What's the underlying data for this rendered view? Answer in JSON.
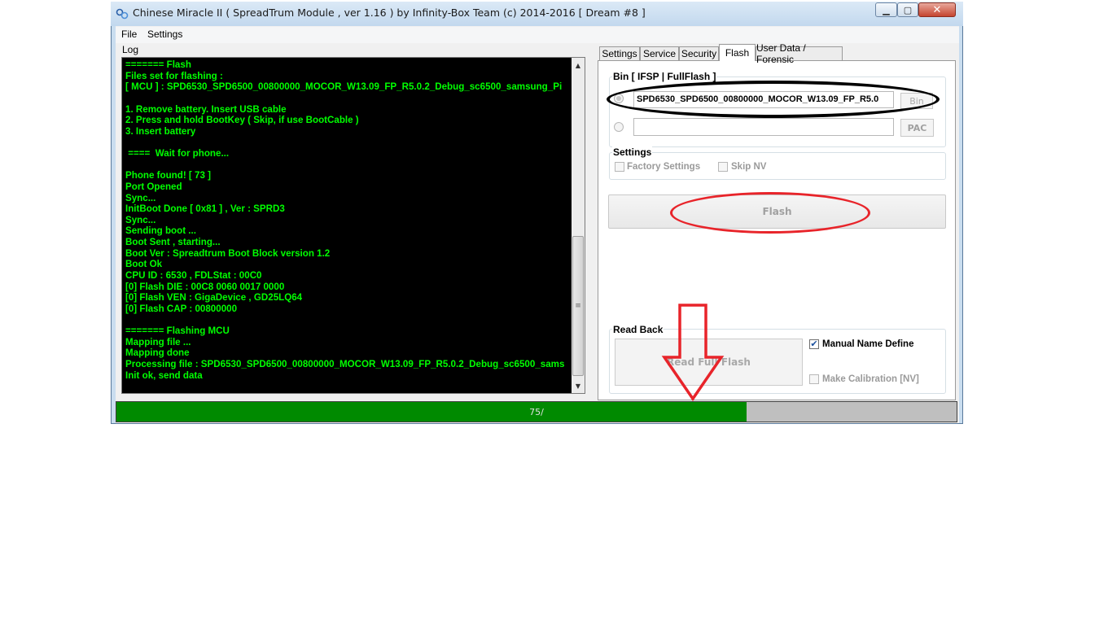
{
  "window": {
    "title": "Chinese Miracle II ( SpreadTrum Module , ver 1.16 ) by Infinity-Box Team (c) 2014-2016 [ Dream #8 ]",
    "minimize_glyph": "▁",
    "maximize_glyph": "▢",
    "close_glyph": "✕"
  },
  "menu": {
    "file": "File",
    "settings": "Settings"
  },
  "log": {
    "label": "Log",
    "lines": [
      "======= Flash",
      "Files set for flashing :",
      "[ MCU ] : SPD6530_SPD6500_00800000_MOCOR_W13.09_FP_R5.0.2_Debug_sc6500_samsung_Pi",
      "",
      "1. Remove battery. Insert USB cable",
      "2. Press and hold BootKey ( Skip, if use BootCable )",
      "3. Insert battery",
      "",
      " ====  Wait for phone...",
      "",
      "Phone found! [ 73 ]",
      "Port Opened",
      "Sync...",
      "InitBoot Done [ 0x81 ] , Ver : SPRD3",
      "Sync...",
      "Sending boot ...",
      "Boot Sent , starting...",
      "Boot Ver : Spreadtrum Boot Block version 1.2",
      "Boot Ok",
      "CPU ID : 6530 , FDLStat : 00C0",
      "[0] Flash DIE : 00C8 0060 0017 0000",
      "[0] Flash VEN : GigaDevice , GD25LQ64",
      "[0] Flash CAP : 00800000",
      "",
      "======= Flashing MCU",
      "Mapping file ...",
      "Mapping done",
      "Processing file : SPD6530_SPD6500_00800000_MOCOR_W13.09_FP_R5.0.2_Debug_sc6500_sams",
      "Init ok, send data"
    ],
    "scroll_up_glyph": "▲",
    "scroll_down_glyph": "▼",
    "scroll_grip_glyph": "≡"
  },
  "tabs": {
    "settings": "Settings",
    "service": "Service",
    "security": "Security",
    "flash": "Flash",
    "userdata": "User Data / Forensic",
    "active": "Flash"
  },
  "bin_group": {
    "title": "Bin  [ IFSP | FullFlash ]",
    "file_value": "SPD6530_SPD6500_00800000_MOCOR_W13.09_FP_R5.0",
    "bin_button": "Bin",
    "pac_button": "PAC",
    "pac_value": ""
  },
  "settings_group": {
    "title": "Settings",
    "factory_settings": "Factory Settings",
    "skip_nv": "Skip NV",
    "factory_checked": false,
    "skip_nv_checked": false
  },
  "flash_button": "Flash",
  "read_back": {
    "title": "Read Back",
    "read_full_flash": "Read Full Flash",
    "manual_name_define": "Manual Name Define",
    "manual_checked": true,
    "check_glyph": "✔",
    "make_calibration": "Make Calibration [NV]",
    "calibration_checked": false
  },
  "progress": {
    "percent": 75,
    "label": "75/"
  },
  "annotations": {
    "ellipse_bin_color": "#000000",
    "ellipse_flash_color": "#e8242a",
    "arrow_color": "#e8242a"
  }
}
